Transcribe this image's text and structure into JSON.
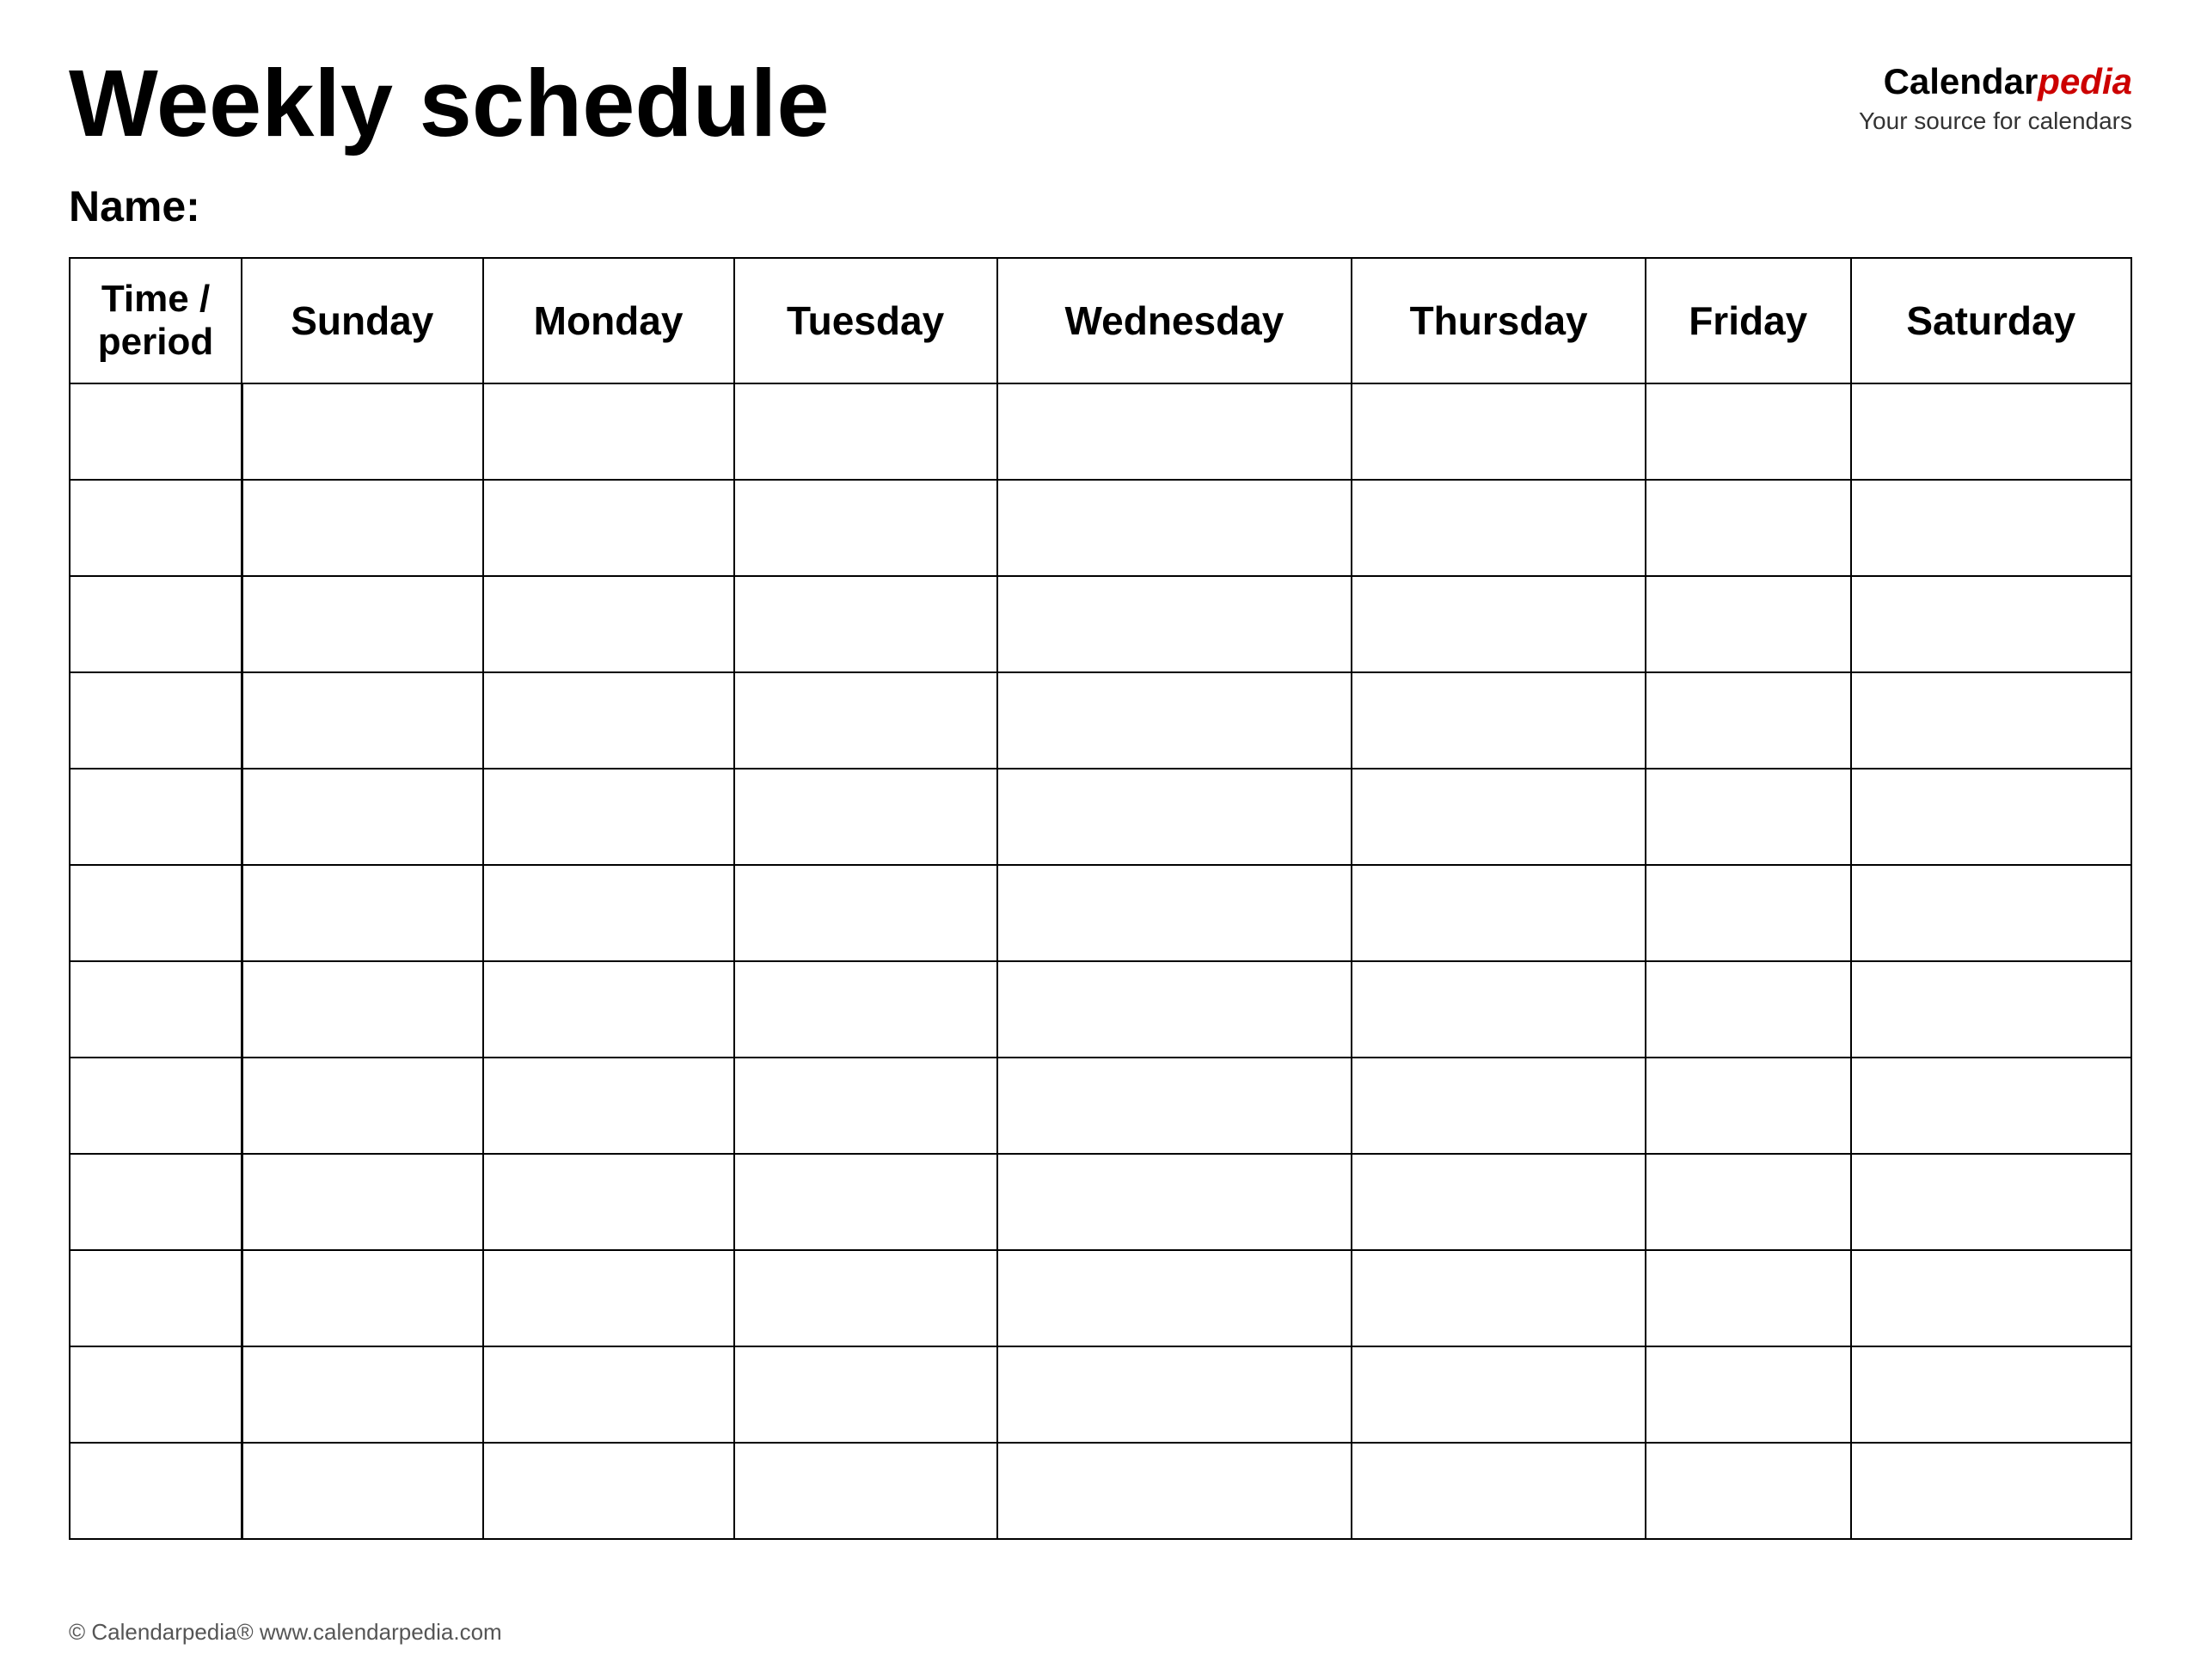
{
  "header": {
    "title": "Weekly schedule",
    "logo": {
      "calendar_text": "Calendar",
      "pedia_text": "pedia",
      "tagline": "Your source for calendars"
    },
    "name_label": "Name:"
  },
  "table": {
    "columns": [
      {
        "key": "time",
        "label": "Time / period"
      },
      {
        "key": "sunday",
        "label": "Sunday"
      },
      {
        "key": "monday",
        "label": "Monday"
      },
      {
        "key": "tuesday",
        "label": "Tuesday"
      },
      {
        "key": "wednesday",
        "label": "Wednesday"
      },
      {
        "key": "thursday",
        "label": "Thursday"
      },
      {
        "key": "friday",
        "label": "Friday"
      },
      {
        "key": "saturday",
        "label": "Saturday"
      }
    ],
    "row_count": 12
  },
  "footer": {
    "text": "© Calendarpedia®  www.calendarpedia.com"
  }
}
